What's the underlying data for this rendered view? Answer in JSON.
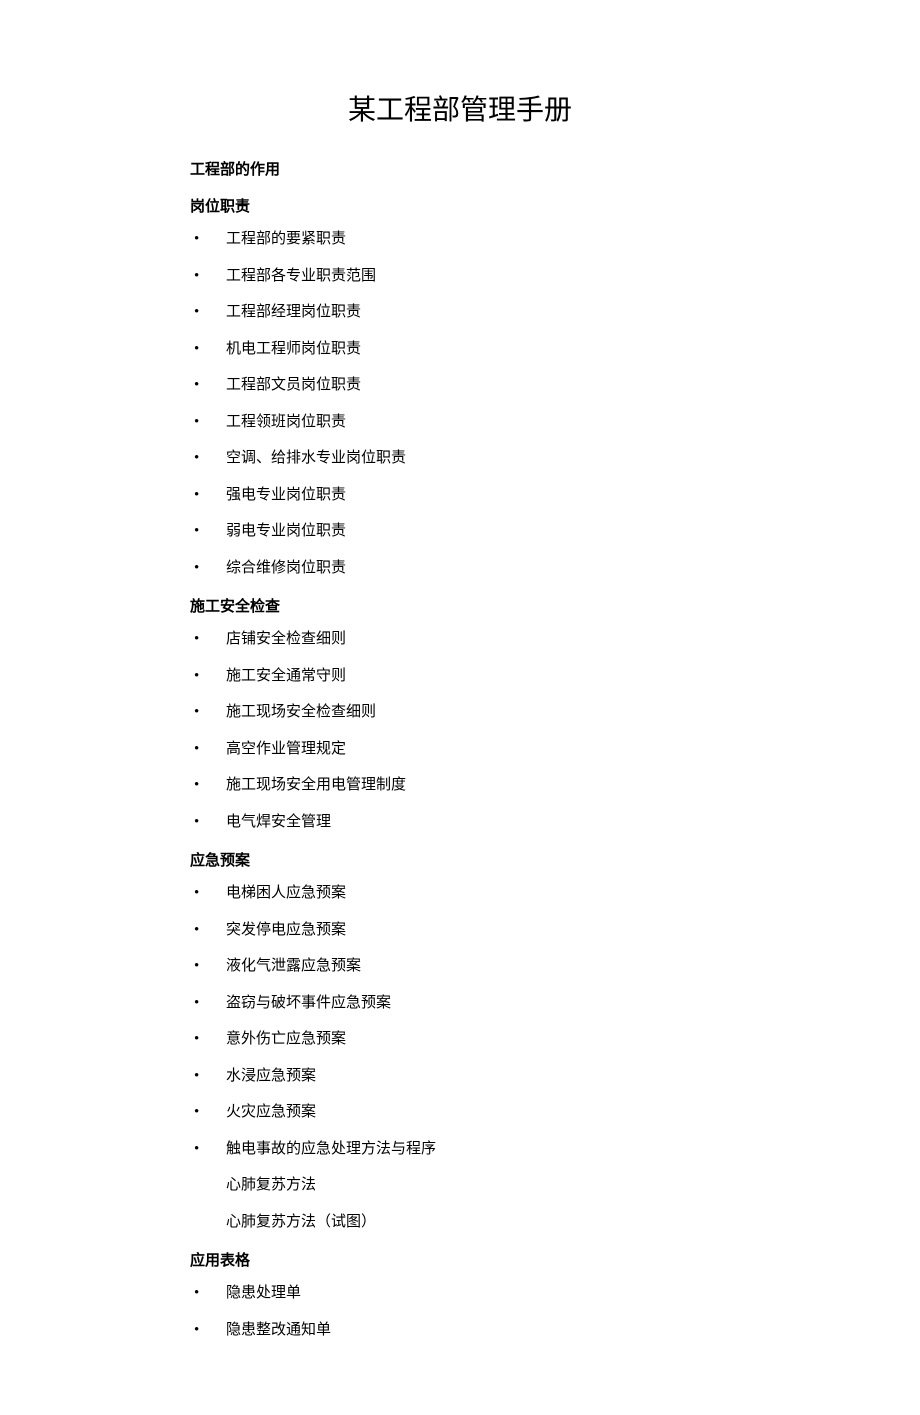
{
  "title": "某工程部管理手册",
  "sections": [
    {
      "heading": "工程部的作用",
      "items": []
    },
    {
      "heading": "岗位职责",
      "items": [
        {
          "text": "工程部的要紧职责",
          "bullet": true
        },
        {
          "text": "工程部各专业职责范围",
          "bullet": true
        },
        {
          "text": "工程部经理岗位职责",
          "bullet": true
        },
        {
          "text": "机电工程师岗位职责",
          "bullet": true
        },
        {
          "text": "工程部文员岗位职责",
          "bullet": true
        },
        {
          "text": "工程领班岗位职责",
          "bullet": true
        },
        {
          "text": "空调、给排水专业岗位职责",
          "bullet": true
        },
        {
          "text": "强电专业岗位职责",
          "bullet": true
        },
        {
          "text": "弱电专业岗位职责",
          "bullet": true
        },
        {
          "text": "综合维修岗位职责",
          "bullet": true
        }
      ]
    },
    {
      "heading": "施工安全检查",
      "items": [
        {
          "text": "店铺安全检查细则",
          "bullet": true
        },
        {
          "text": "施工安全通常守则",
          "bullet": true
        },
        {
          "text": "施工现场安全检查细则",
          "bullet": true
        },
        {
          "text": "高空作业管理规定",
          "bullet": true
        },
        {
          "text": "施工现场安全用电管理制度",
          "bullet": true
        },
        {
          "text": "电气焊安全管理",
          "bullet": true
        }
      ]
    },
    {
      "heading": "应急预案",
      "items": [
        {
          "text": "电梯困人应急预案",
          "bullet": true
        },
        {
          "text": "突发停电应急预案",
          "bullet": true
        },
        {
          "text": "液化气泄露应急预案",
          "bullet": true
        },
        {
          "text": "盗窃与破坏事件应急预案",
          "bullet": true
        },
        {
          "text": "意外伤亡应急预案",
          "bullet": true
        },
        {
          "text": "水浸应急预案",
          "bullet": true
        },
        {
          "text": "火灾应急预案",
          "bullet": true
        },
        {
          "text": "触电事故的应急处理方法与程序",
          "bullet": true
        },
        {
          "text": "心肺复苏方法",
          "bullet": false
        },
        {
          "text": "心肺复苏方法（试图）",
          "bullet": false
        }
      ]
    },
    {
      "heading": "应用表格",
      "items": [
        {
          "text": "隐患处理单",
          "bullet": true
        },
        {
          "text": "隐患整改通知单",
          "bullet": true
        }
      ]
    }
  ]
}
